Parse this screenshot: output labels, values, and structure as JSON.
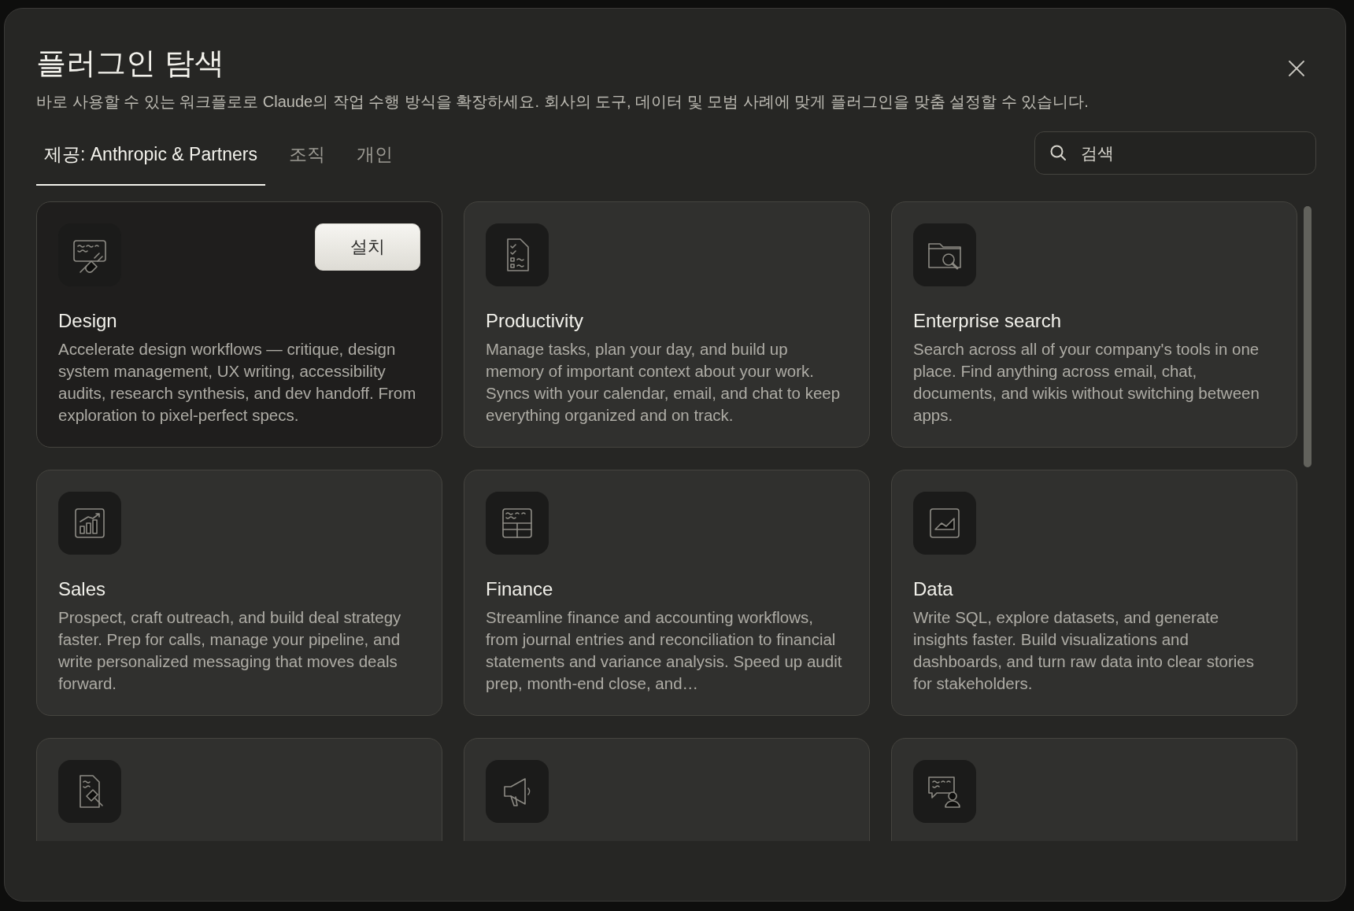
{
  "dialog": {
    "title": "플러그인 탐색",
    "subtitle": "바로 사용할 수 있는 워크플로로 Claude의 작업 수행 방식을 확장하세요. 회사의 도구, 데이터 및 모범 사례에 맞게 플러그인을 맞춤 설정할 수 있습니다."
  },
  "tabs": [
    {
      "label": "제공: Anthropic & Partners",
      "selected": true
    },
    {
      "label": "조직",
      "selected": false
    },
    {
      "label": "개인",
      "selected": false
    }
  ],
  "search": {
    "placeholder": "검색"
  },
  "plugins": [
    {
      "name": "Design",
      "description": "Accelerate design workflows — critique, design system management, UX writing, accessibility audits, research synthesis, and dev handoff. From exploration to pixel-perfect specs.",
      "hovered": true,
      "install_label": "설치"
    },
    {
      "name": "Productivity",
      "description": "Manage tasks, plan your day, and build up memory of important context about your work. Syncs with your calendar, email, and chat to keep everything organized and on track.",
      "hovered": false
    },
    {
      "name": "Enterprise search",
      "description": "Search across all of your company's tools in one place. Find anything across email, chat, documents, and wikis without switching between apps.",
      "hovered": false
    },
    {
      "name": "Sales",
      "description": "Prospect, craft outreach, and build deal strategy faster. Prep for calls, manage your pipeline, and write personalized messaging that moves deals forward.",
      "hovered": false
    },
    {
      "name": "Finance",
      "description": "Streamline finance and accounting workflows, from journal entries and reconciliation to financial statements and variance analysis. Speed up audit prep, month-end close, and…",
      "hovered": false
    },
    {
      "name": "Data",
      "description": "Write SQL, explore datasets, and generate insights faster. Build visualizations and dashboards, and turn raw data into clear stories for stakeholders.",
      "hovered": false
    },
    {
      "hovered": false
    },
    {
      "hovered": false
    },
    {
      "hovered": false
    }
  ]
}
